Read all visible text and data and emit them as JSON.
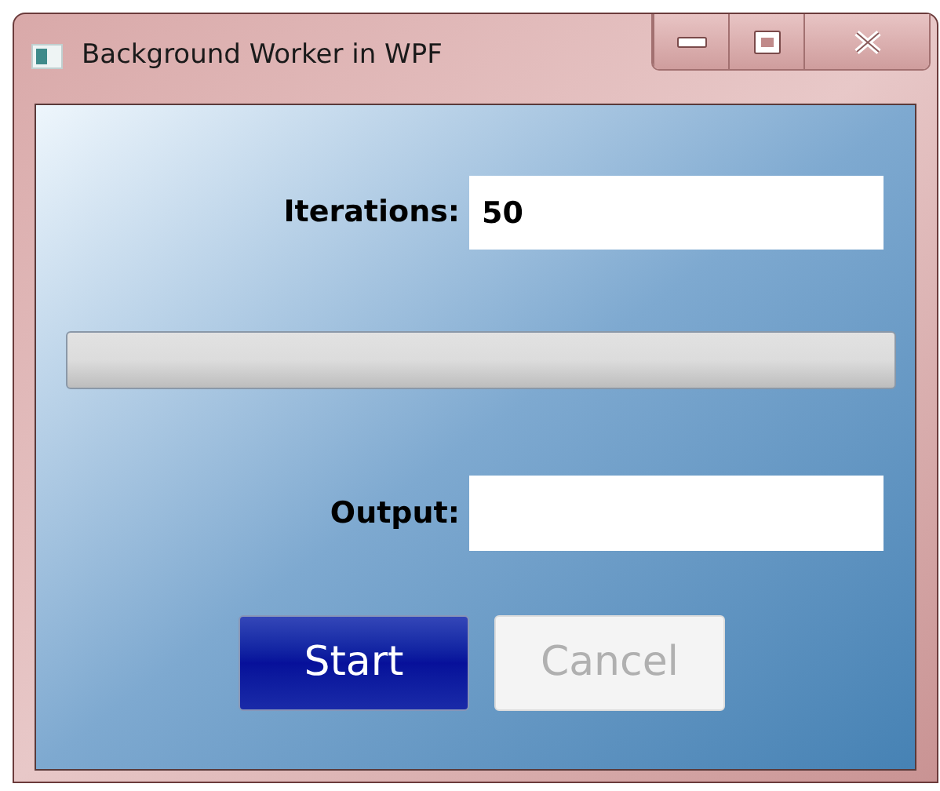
{
  "window": {
    "title": "Background Worker in WPF",
    "controls": [
      {
        "kind": "minimize"
      },
      {
        "kind": "maximize"
      },
      {
        "kind": "close"
      }
    ]
  },
  "iterations": {
    "label": "Iterations:",
    "value": "50"
  },
  "progress": {
    "level": 0
  },
  "output": {
    "label": "Output:"
  },
  "buttons": [
    {
      "label": "Start",
      "disabled": false
    },
    {
      "label": "Cancel",
      "disabled": true
    }
  ]
}
